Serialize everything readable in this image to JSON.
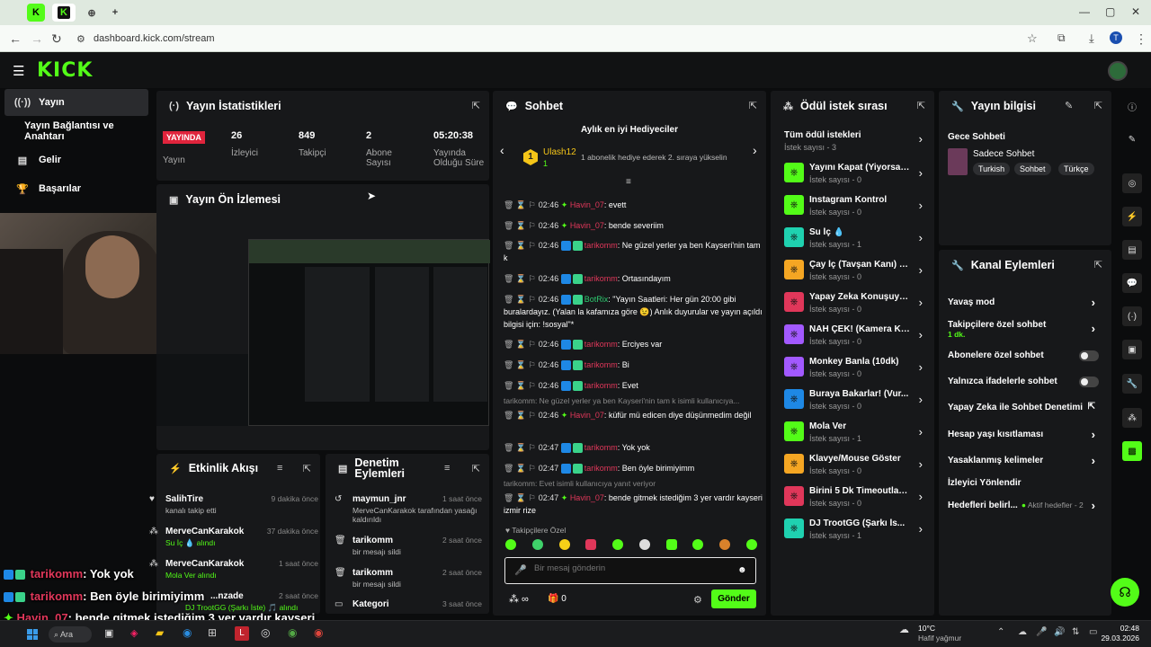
{
  "browser": {
    "url": "dashboard.kick.com/stream",
    "new_tab": "+",
    "profile_initial": "T"
  },
  "nav": {
    "items": [
      {
        "label": "Yayın",
        "icon": "broadcast-icon",
        "active": true
      },
      {
        "label": "Yayın Bağlantısı ve Anahtarı",
        "icon": "",
        "active": false
      },
      {
        "label": "Gelir",
        "icon": "chart-icon",
        "active": false
      },
      {
        "label": "Başarılar",
        "icon": "trophy-icon",
        "active": false
      }
    ]
  },
  "stats": {
    "title": "Yayın İstatistikleri",
    "live_badge": "YAYINDA",
    "live_label": "Yayın",
    "viewers_value": "26",
    "viewers_label": "İzleyici",
    "followers_value": "849",
    "followers_label": "Takipçi",
    "subs_value": "2",
    "subs_label": "Abone Sayısı",
    "uptime_value": "05:20:38",
    "uptime_label": "Yayında Olduğu Süre"
  },
  "preview": {
    "title": "Yayın Ön İzlemesi"
  },
  "chat": {
    "title": "Sohbet",
    "gifter_title": "Aylık en iyi Hediyeciler",
    "gifter_rank": "1",
    "gifter_name": "Ulash12",
    "gifter_count": "1",
    "gifter_note": "1 abonelik hediye ederek 2. sıraya yükselin",
    "messages": [
      {
        "time": "02:46",
        "user": "Havin_07",
        "text": ": evett"
      },
      {
        "time": "02:46",
        "user": "Havin_07",
        "text": ": bende severiim"
      },
      {
        "time": "02:46",
        "user": "tarikomm",
        "text": ": Ne güzel yerler ya ben Kayseri'nin tam k"
      },
      {
        "time": "02:46",
        "user": "tarikomm",
        "text": ": Ortasındayım"
      },
      {
        "time": "02:46",
        "user": "BotRix",
        "text": ": \"Yayın Saatleri: Her gün 20:00 gibi buralardayız. (Yalan la kafamıza göre 😉) Anlık duyurular ve yayın açıldı bilgisi için: !sosyal\"*"
      },
      {
        "time": "02:46",
        "user": "tarikomm",
        "text": ": Erciyes var"
      },
      {
        "time": "02:46",
        "user": "tarikomm",
        "text": ": Bi"
      },
      {
        "time": "02:46",
        "user": "tarikomm",
        "text": ": Evet"
      },
      {
        "time": "02:46",
        "user": "Havin_07",
        "text": ": küfür mü edicen diye düşünmedim değil"
      },
      {
        "time": "02:47",
        "user": "tarikomm",
        "text": ": Yok yok"
      },
      {
        "time": "02:47",
        "user": "tarikomm",
        "text": ": Ben öyle birimiyimm"
      },
      {
        "time": "02:47",
        "user": "Havin_07",
        "text": ": bende gitmek istediğim 3 yer vardır kayseri izmir rize"
      }
    ],
    "reply1": "tarikomm: Ne güzel yerler ya ben Kayseri'nin tam k isimli kullanıcıya...",
    "reply2": "tarikomm: Evet isimli kullanıcıya yanıt veriyor",
    "followers_only": "Takipçilere Özel",
    "input_placeholder": "Bir mesaj gönderin",
    "send_label": "Gönder",
    "points": "0"
  },
  "rewards": {
    "title": "Ödül istek sırası",
    "all_label": "Tüm ödül istekleri",
    "all_count": "İstek sayısı - 3",
    "items": [
      {
        "name": "Yayını Kapat (Yiyorsa)...",
        "count": "İstek sayısı - 0",
        "color": "#53fc18"
      },
      {
        "name": "Instagram Kontrol",
        "count": "İstek sayısı - 0",
        "color": "#53fc18"
      },
      {
        "name": "Su İç 💧",
        "count": "İstek sayısı - 1",
        "color": "#1fd1b0"
      },
      {
        "name": "Çay İç (Tavşan Kanı) 🟣",
        "count": "İstek sayısı - 0",
        "color": "#f5a623"
      },
      {
        "name": "Yapay Zeka Konuşuyo...",
        "count": "İstek sayısı - 0",
        "color": "#e0375a"
      },
      {
        "name": "NAH ÇEK! (Kamera Ka...",
        "count": "İstek sayısı - 0",
        "color": "#a259ff"
      },
      {
        "name": "Monkey Banla (10dk)",
        "count": "İstek sayısı - 0",
        "color": "#a259ff"
      },
      {
        "name": "Buraya Bakarlar! (Vur...",
        "count": "İstek sayısı - 0",
        "color": "#1e88e5"
      },
      {
        "name": "Mola Ver",
        "count": "İstek sayısı - 1",
        "color": "#53fc18"
      },
      {
        "name": "Klavye/Mouse Göster",
        "count": "İstek sayısı - 0",
        "color": "#f5a623"
      },
      {
        "name": "Birini 5 Dk Timeoutla 🔨",
        "count": "İstek sayısı - 0",
        "color": "#e0375a"
      },
      {
        "name": "DJ TrootGG (Şarkı İs...",
        "count": "İstek sayısı - 1",
        "color": "#1fd1b0"
      }
    ]
  },
  "info": {
    "title": "Yayın bilgisi",
    "stream_title": "Gece Sohbeti",
    "category": "Sadece Sohbet",
    "tags": [
      "Turkish",
      "Sohbet",
      "Türkçe"
    ]
  },
  "channel": {
    "title": "Kanal Eylemleri",
    "slow_mode": "Yavaş mod",
    "followers_chat": "Takipçilere özel sohbet",
    "followers_chat_sub": "1 dk.",
    "subs_chat": "Abonelere özel sohbet",
    "emotes_chat": "Yalnızca ifadelerle sohbet",
    "ai_mod": "Yapay Zeka ile Sohbet Denetimi",
    "age_limit": "Hesap yaşı kısıtlaması",
    "banned_words": "Yasaklanmış kelimeler",
    "redirect": "İzleyici Yönlendir",
    "targets": "Hedefleri belirl...",
    "targets_sub": "Aktif hedefler - 2"
  },
  "feed": {
    "title": "Etkinlik Akışı",
    "items": [
      {
        "name": "SalihTire",
        "sub": "kanalı takip etti",
        "time": "9 dakika önce"
      },
      {
        "name": "MerveCanKarakok",
        "sub": "Su İç 💧 alındı",
        "time": "37 dakika önce"
      },
      {
        "name": "MerveCanKarakok",
        "sub": "Mola Ver alındı",
        "time": "1 saat önce"
      },
      {
        "name": "...nzade",
        "sub": "DJ TrootGG (Şarkı İste) 🎵 alındı",
        "time": "2 saat önce"
      }
    ]
  },
  "moderation": {
    "title": "Denetim Eylemleri",
    "items": [
      {
        "name": "maymun_jnr",
        "sub": "MerveCanKarakok tarafından yasağı kaldırıldı",
        "time": "1 saat önce"
      },
      {
        "name": "tarikomm",
        "sub": "bir mesajı sildi",
        "time": "2 saat önce"
      },
      {
        "name": "tarikomm",
        "sub": "bir mesajı sildi",
        "time": "2 saat önce"
      },
      {
        "name": "Kategori",
        "sub": "",
        "time": "3 saat önce"
      }
    ]
  },
  "overlay": [
    {
      "user": "tarikomm",
      "text": ": Yok yok"
    },
    {
      "user": "tarikomm",
      "text": ": Ben öyle birimiyimm"
    },
    {
      "user": "Havin_07",
      "text": ": bende gitmek istediğim 3 yer vardır kayseri"
    },
    {
      "user": "",
      "text": "izmir rize"
    }
  ],
  "taskbar": {
    "search": "Ara",
    "weather_temp": "10°C",
    "weather_desc": "Hafif yağmur",
    "time": "02:48",
    "date": "29.03.2026"
  }
}
